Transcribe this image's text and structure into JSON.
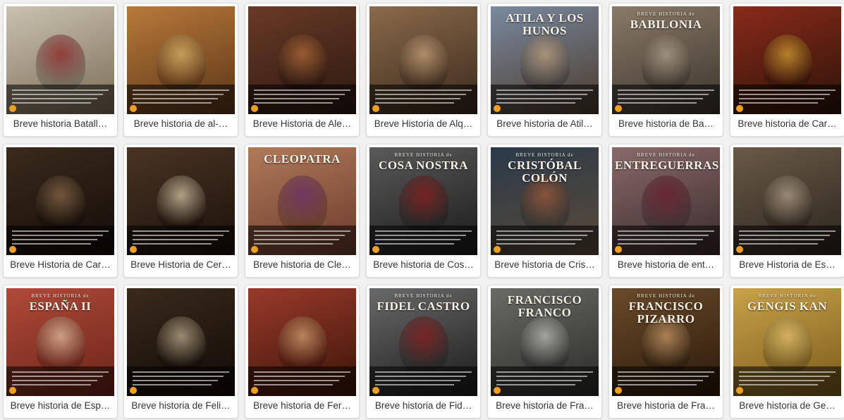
{
  "books": [
    {
      "label": "Breve historia Batall…",
      "cover_title": "",
      "cover_small": "",
      "colors": [
        "#c9c2b0",
        "#7a6b55"
      ],
      "accent": "#8a2020"
    },
    {
      "label": "Breve historia de al-…",
      "cover_title": "",
      "cover_small": "",
      "colors": [
        "#b87a3a",
        "#5a3418"
      ],
      "accent": "#d8b26a"
    },
    {
      "label": "Breve Historia de Ale…",
      "cover_title": "",
      "cover_small": "",
      "colors": [
        "#6a3a26",
        "#2a1810"
      ],
      "accent": "#b06a3a"
    },
    {
      "label": "Breve Historia de Alq…",
      "cover_title": "",
      "cover_small": "",
      "colors": [
        "#8a6a4a",
        "#3a2a1c"
      ],
      "accent": "#c8a27a"
    },
    {
      "label": "Breve historia de Atil…",
      "cover_title": "ATILA Y LOS HUNOS",
      "cover_small": "",
      "colors": [
        "#7a8aa0",
        "#4a3a2a"
      ],
      "accent": "#c0a080"
    },
    {
      "label": "Breve historia de Ba…",
      "cover_title": "BABILONIA",
      "cover_small": "BREVE HISTORIA de",
      "colors": [
        "#8a7a68",
        "#3a342c"
      ],
      "accent": "#b0a08c"
    },
    {
      "label": "Breve historia de Car…",
      "cover_title": "",
      "cover_small": "",
      "colors": [
        "#8a2a1a",
        "#2a1408"
      ],
      "accent": "#d0a030"
    },
    {
      "label": "Breve Historia de Car…",
      "cover_title": "",
      "cover_small": "",
      "colors": [
        "#3a2a1c",
        "#140c08"
      ],
      "accent": "#8a6a4a"
    },
    {
      "label": "Breve Historia de Cer…",
      "cover_title": "",
      "cover_small": "",
      "colors": [
        "#4a3424",
        "#1a100a"
      ],
      "accent": "#d8c8a8"
    },
    {
      "label": "Breve historia de Cle…",
      "cover_title": "CLEOPATRA",
      "cover_small": "",
      "colors": [
        "#b07a5a",
        "#6a3a2a"
      ],
      "accent": "#6a2a6a"
    },
    {
      "label": "Breve historia de Cos…",
      "cover_title": "COSA NOSTRA",
      "cover_small": "BREVE HISTORIA de",
      "colors": [
        "#5a5a5a",
        "#1a1a1a"
      ],
      "accent": "#8a1a1a"
    },
    {
      "label": "Breve historia de Cris…",
      "cover_title": "CRISTÓBAL COLÓN",
      "cover_small": "BREVE HISTORIA de",
      "colors": [
        "#2a3a4a",
        "#5a4a38"
      ],
      "accent": "#a05a3a"
    },
    {
      "label": "Breve historia de ent…",
      "cover_title": "ENTREGUERRAS",
      "cover_small": "BREVE HISTORIA de",
      "colors": [
        "#8a6a6a",
        "#3a2a2a"
      ],
      "accent": "#6a1a2a"
    },
    {
      "label": "Breve Historia de Es…",
      "cover_title": "",
      "cover_small": "",
      "colors": [
        "#6a5a48",
        "#2a241c"
      ],
      "accent": "#b0a088"
    },
    {
      "label": "Breve historia de Esp…",
      "cover_title": "ESPAÑA II",
      "cover_small": "BREVE HISTORIA de",
      "colors": [
        "#b04a3a",
        "#6a2418"
      ],
      "accent": "#e0c0a0"
    },
    {
      "label": "Breve historia de Feli…",
      "cover_title": "",
      "cover_small": "",
      "colors": [
        "#3a2a1c",
        "#100a06"
      ],
      "accent": "#c0b090"
    },
    {
      "label": "Breve historia de Fer…",
      "cover_title": "",
      "cover_small": "",
      "colors": [
        "#9a3a2a",
        "#3a1408"
      ],
      "accent": "#d0a070"
    },
    {
      "label": "Breve historia de Fid…",
      "cover_title": "FIDEL CASTRO",
      "cover_small": "BREVE HISTORIA de",
      "colors": [
        "#6a6a6a",
        "#1a1a1a"
      ],
      "accent": "#8a1a1a"
    },
    {
      "label": "Breve historia de Fra…",
      "cover_title": "FRANCISCO FRANCO",
      "cover_small": "",
      "colors": [
        "#6a6a66",
        "#2a2a28"
      ],
      "accent": "#c0c0b8"
    },
    {
      "label": "Breve historia de Fra…",
      "cover_title": "FRANCISCO PIZARRO",
      "cover_small": "BREVE HISTORIA de",
      "colors": [
        "#6a4a2a",
        "#2a1a0a"
      ],
      "accent": "#c89a6a"
    },
    {
      "label": "Breve historia de Ge…",
      "cover_title": "GENGIS KAN",
      "cover_small": "BREVE HISTORIA de",
      "colors": [
        "#c8a24a",
        "#7a5a1a"
      ],
      "accent": "#e0c070"
    }
  ]
}
